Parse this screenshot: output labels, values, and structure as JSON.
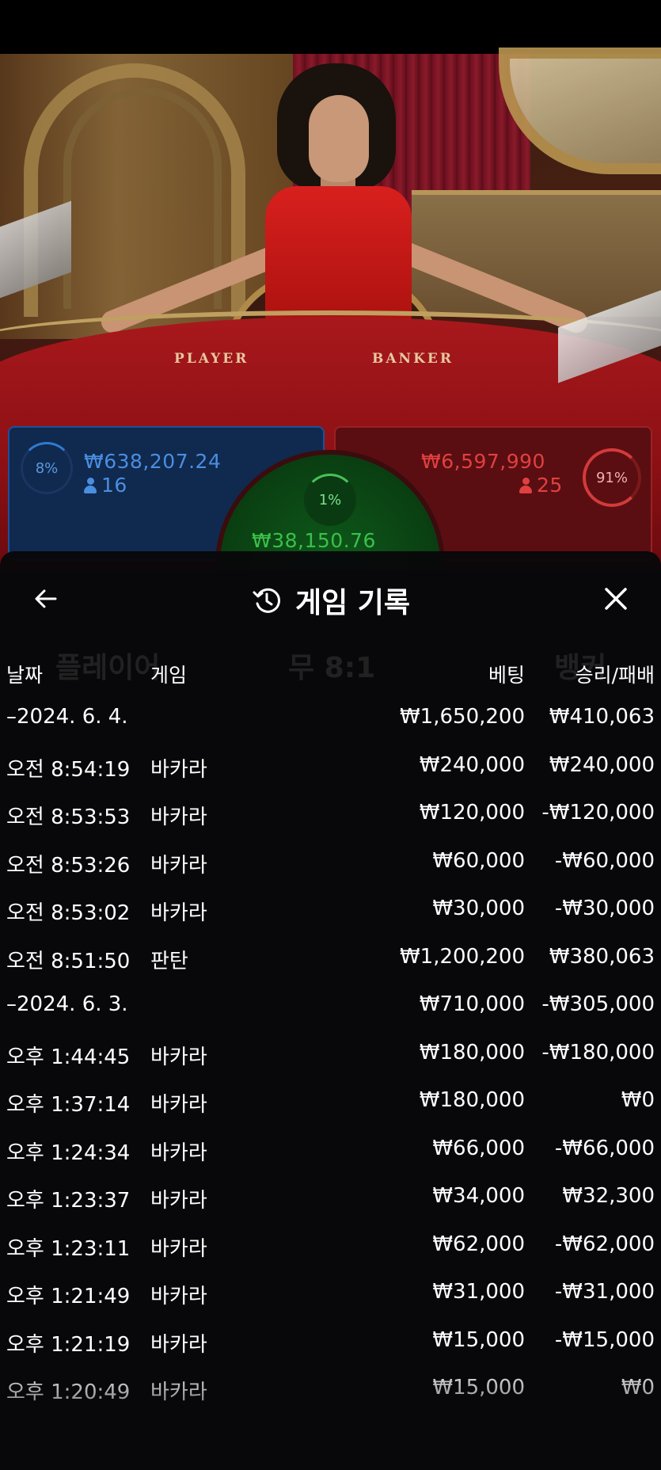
{
  "video": {
    "table_labels": {
      "player": "PLAYER",
      "banker": "BANKER"
    }
  },
  "bets": {
    "player": {
      "percent": "8%",
      "amount": "₩638,207.24",
      "players": "16",
      "color": "#4a8ee0"
    },
    "banker": {
      "percent": "91%",
      "amount": "₩6,597,990",
      "players": "25",
      "color": "#e04040"
    },
    "tie": {
      "percent": "1%",
      "amount": "₩38,150.76",
      "color": "#3ac04a"
    }
  },
  "history": {
    "title": "게임 기록",
    "icons": {
      "back": "arrow-left-icon",
      "history": "history-clock-icon",
      "close": "close-icon"
    },
    "columns": {
      "date": "날짜",
      "game": "게임",
      "bet": "베팅",
      "result": "승리/패배"
    },
    "rows": [
      {
        "date": "–2024. 6. 4.",
        "game": "",
        "bet": "₩1,650,200",
        "result": "₩410,063"
      },
      {
        "date": "오전 8:54:19",
        "game": "바카라",
        "bet": "₩240,000",
        "result": "₩240,000"
      },
      {
        "date": "오전 8:53:53",
        "game": "바카라",
        "bet": "₩120,000",
        "result": "-₩120,000"
      },
      {
        "date": "오전 8:53:26",
        "game": "바카라",
        "bet": "₩60,000",
        "result": "-₩60,000"
      },
      {
        "date": "오전 8:53:02",
        "game": "바카라",
        "bet": "₩30,000",
        "result": "-₩30,000"
      },
      {
        "date": "오전 8:51:50",
        "game": "판탄",
        "bet": "₩1,200,200",
        "result": "₩380,063"
      },
      {
        "date": "–2024. 6. 3.",
        "game": "",
        "bet": "₩710,000",
        "result": "-₩305,000"
      },
      {
        "date": "오후 1:44:45",
        "game": "바카라",
        "bet": "₩180,000",
        "result": "-₩180,000"
      },
      {
        "date": "오후 1:37:14",
        "game": "바카라",
        "bet": "₩180,000",
        "result": "₩0"
      },
      {
        "date": "오후 1:24:34",
        "game": "바카라",
        "bet": "₩66,000",
        "result": "-₩66,000"
      },
      {
        "date": "오후 1:23:37",
        "game": "바카라",
        "bet": "₩34,000",
        "result": "₩32,300"
      },
      {
        "date": "오후 1:23:11",
        "game": "바카라",
        "bet": "₩62,000",
        "result": "-₩62,000"
      },
      {
        "date": "오후 1:21:49",
        "game": "바카라",
        "bet": "₩31,000",
        "result": "-₩31,000"
      },
      {
        "date": "오후 1:21:19",
        "game": "바카라",
        "bet": "₩15,000",
        "result": "-₩15,000"
      },
      {
        "date": "오후 1:20:49",
        "game": "바카라",
        "bet": "₩15,000",
        "result": "₩0"
      }
    ]
  },
  "background_ghost_text": {
    "player_label": "플레이어",
    "tie_label": "무 8:1",
    "banker_label": "뱅커"
  }
}
